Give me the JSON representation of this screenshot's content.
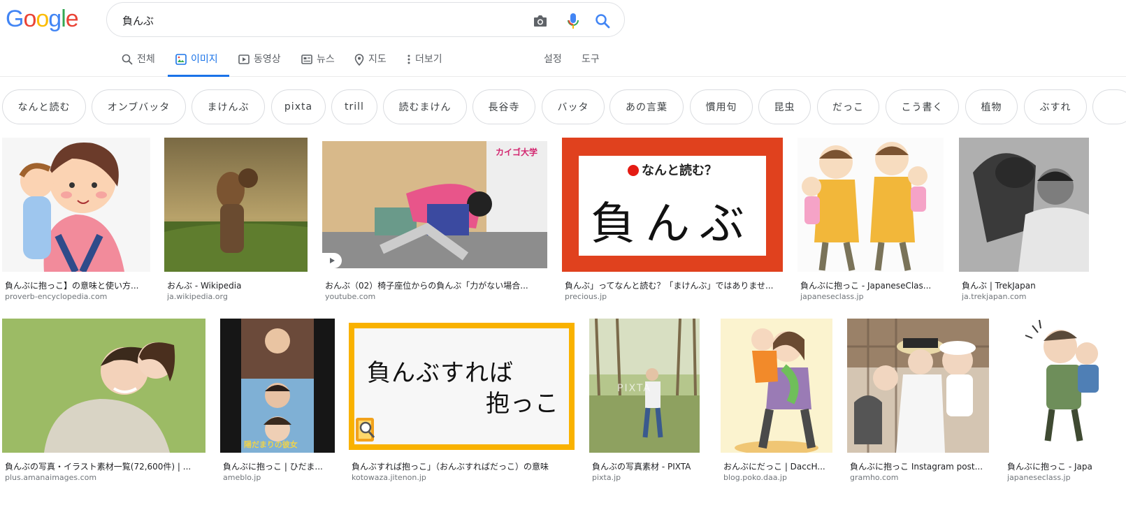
{
  "logo_text": "Google",
  "colors": {
    "blue": "#4285F4",
    "red": "#EA4335",
    "yellow": "#FBBC05",
    "green": "#34A853",
    "accent": "#1a73e8"
  },
  "search": {
    "query": "負んぶ"
  },
  "icons": {
    "camera": "camera-icon",
    "mic": "mic-icon",
    "search": "search-icon"
  },
  "tabs": [
    {
      "label": "전체",
      "icon": "search-icon",
      "active": false
    },
    {
      "label": "이미지",
      "icon": "image-icon",
      "active": true
    },
    {
      "label": "동영상",
      "icon": "video-icon",
      "active": false
    },
    {
      "label": "뉴스",
      "icon": "news-icon",
      "active": false
    },
    {
      "label": "지도",
      "icon": "map-pin-icon",
      "active": false
    },
    {
      "label": "더보기",
      "icon": "more-vert-icon",
      "active": false
    }
  ],
  "tools": {
    "settings": "설정",
    "tools": "도구"
  },
  "chips": [
    "なんと読む",
    "オンブバッタ",
    "まけんぶ",
    "pixta",
    "trill",
    "読むまけん",
    "長谷寺",
    "バッタ",
    "あの言葉",
    "慣用句",
    "昆虫",
    "だっこ",
    "こう書く",
    "植物",
    "ぶすれ"
  ],
  "results": [
    {
      "title": "負んぶに抱っこ】の意味と使い方...",
      "domain": "proverb-encyclopedia.com"
    },
    {
      "title": "おんぶ - Wikipedia",
      "domain": "ja.wikipedia.org"
    },
    {
      "title": "おんぶ（02）椅子座位からの負んぶ「力がない場合...",
      "domain": "youtube.com",
      "overlay": "カイゴ大学"
    },
    {
      "title": "負んぶ」ってなんと読む？「まけんぶ」ではありませ...",
      "domain": "precious.jp",
      "overlay_top": "なんと読む？",
      "overlay_main": "負んぶ"
    },
    {
      "title": "負んぶに抱っこ - JapaneseClas...",
      "domain": "japaneseclass.jp"
    },
    {
      "title": "負んぶ | TrekJapan",
      "domain": "ja.trekjapan.com"
    },
    {
      "title": "負んぶの写真・イラスト素材一覧(72,600件) | ...",
      "domain": "plus.amanaimages.com"
    },
    {
      "title": "負んぶに抱っこ | ひだま...",
      "domain": "ameblo.jp"
    },
    {
      "title": "負んぶすれば抱っこ」（おんぶすればだっこ）の意味",
      "domain": "kotowaza.jitenon.jp",
      "overlay_line1": "負んぶすれば",
      "overlay_line2": "抱っこ"
    },
    {
      "title": "負んぶの写真素材 - PIXTA",
      "domain": "pixta.jp",
      "overlay": "PIXTA"
    },
    {
      "title": "おんぶにだっこ | DaccH...",
      "domain": "blog.poko.daa.jp"
    },
    {
      "title": "負んぶに抱っこ Instagram post...",
      "domain": "gramho.com"
    },
    {
      "title": "負んぶに抱っこ - Japa",
      "domain": "japaneseclass.jp"
    }
  ]
}
